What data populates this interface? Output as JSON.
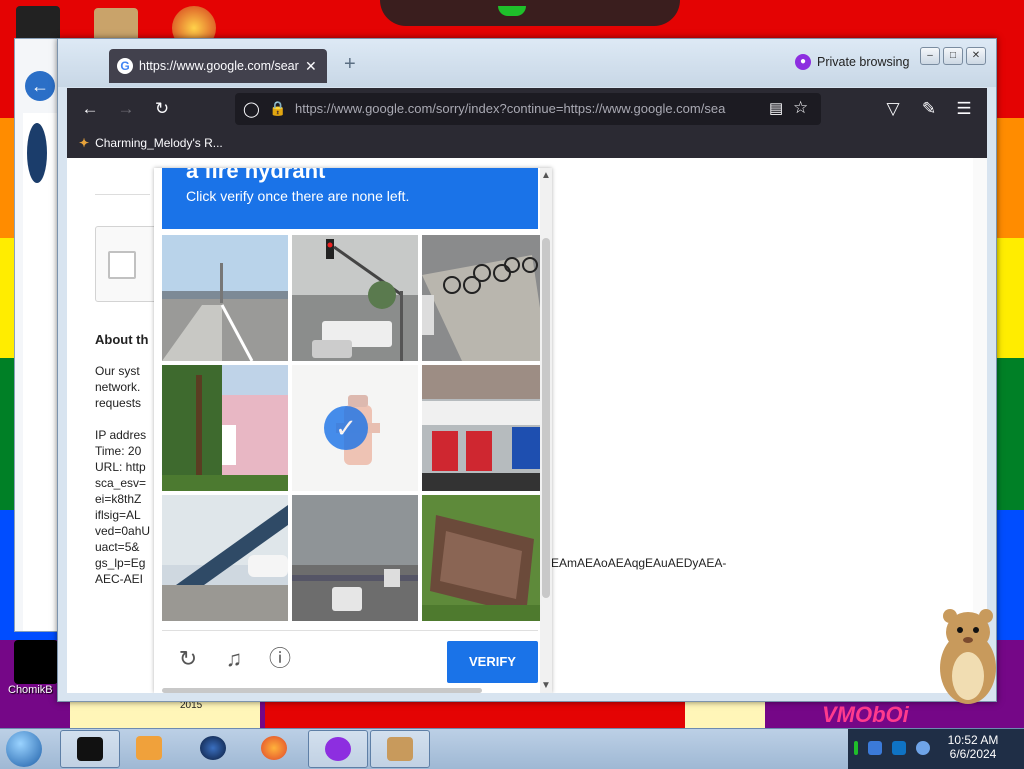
{
  "browser": {
    "tab_title": "https://www.google.com/sear",
    "private_label": "Private browsing",
    "url": "https://www.google.com/sorry/index?continue=https://www.google.com/sea",
    "bookmark": "Charming_Melody's R..."
  },
  "page": {
    "about_title": "About th",
    "lines": [
      "Our syst",
      "network.",
      "requests",
      "",
      "IP addres",
      "Time: 20",
      "URL: http",
      "sca_esv=",
      "ei=k8thZ",
      "iflsig=AL",
      "ved=0ahU",
      "uact=5&",
      "gs_lp=Eg",
      "AEC-AEI"
    ],
    "url_tail": "AEAmAEAoAEAqgEAuAEDyAEA-"
  },
  "captcha": {
    "title": "a fire hydrant",
    "instruction": "Click verify once there are none left.",
    "verify_label": "VERIFY",
    "tiles": [
      {
        "id": "road-overpass",
        "selected": false
      },
      {
        "id": "traffic-light-street",
        "selected": false
      },
      {
        "id": "bicycles-parking",
        "selected": false
      },
      {
        "id": "pink-house-tree",
        "selected": false
      },
      {
        "id": "fire-hydrant-snow",
        "selected": true
      },
      {
        "id": "trucks-parking",
        "selected": false
      },
      {
        "id": "stairs-building",
        "selected": false
      },
      {
        "id": "highway-pickup",
        "selected": false
      },
      {
        "id": "rusty-sign-bushes",
        "selected": false
      }
    ]
  },
  "desktop": {
    "icon_label": "ChomikB",
    "wallpaper_text": "VMObOi",
    "wallpaper_text_small": "2015"
  },
  "taskbar": {
    "time": "10:52 AM",
    "date": "6/6/2024"
  },
  "colors": {
    "accent": "#1a73e8",
    "private": "#8d2ee0"
  }
}
